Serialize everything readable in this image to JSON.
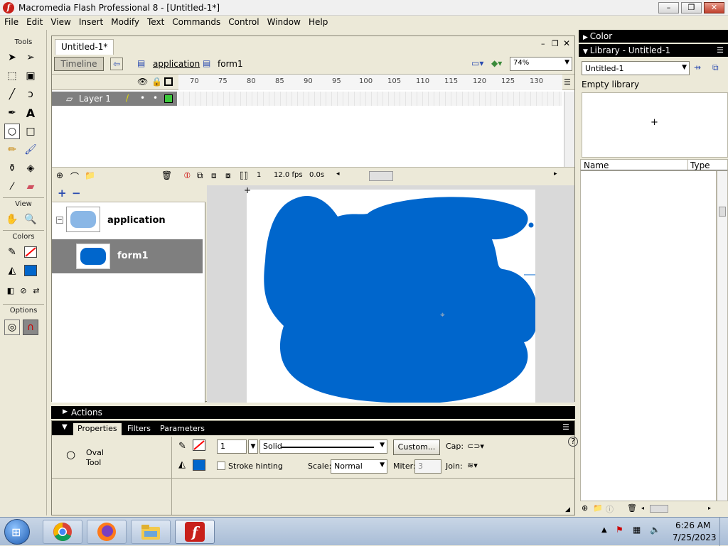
{
  "window": {
    "title": "Macromedia Flash Professional 8 - [Untitled-1*]",
    "app_icon": "f"
  },
  "menu": [
    "File",
    "Edit",
    "View",
    "Insert",
    "Modify",
    "Text",
    "Commands",
    "Control",
    "Window",
    "Help"
  ],
  "tools": {
    "label": "Tools",
    "view_label": "View",
    "colors_label": "Colors",
    "options_label": "Options",
    "stroke_color": "#ff0000",
    "fill_color": "#0066cc"
  },
  "document": {
    "tab": "Untitled-1*",
    "timeline_button": "Timeline",
    "breadcrumb": [
      "application",
      "form1"
    ],
    "zoom": "74%",
    "layer_name": "Layer 1",
    "ruler": [
      "70",
      "75",
      "80",
      "85",
      "90",
      "95",
      "100",
      "105",
      "110",
      "115",
      "120",
      "125",
      "130"
    ],
    "frame": "1",
    "fps": "12.0 fps",
    "time": "0.0s"
  },
  "screens": {
    "items": [
      {
        "label": "application"
      },
      {
        "label": "form1"
      }
    ]
  },
  "stage": {
    "shape_color": "#0066cc"
  },
  "actions_label": "Actions",
  "properties": {
    "tabs": [
      "Properties",
      "Filters",
      "Parameters"
    ],
    "tool_name_line1": "Oval",
    "tool_name_line2": "Tool",
    "stroke_height": "1",
    "stroke_style": "Solid",
    "custom_button": "Custom...",
    "cap_label": "Cap:",
    "stroke_hinting_label": "Stroke hinting",
    "scale_label": "Scale:",
    "scale_value": "Normal",
    "miter_label": "Miter:",
    "miter_value": "3",
    "join_label": "Join:"
  },
  "right_panel": {
    "color_header": "Color",
    "library_header": "Library - Untitled-1",
    "library_select": "Untitled-1",
    "empty_text": "Empty library",
    "col_name": "Name",
    "col_type": "Type"
  },
  "taskbar": {
    "time": "6:26 AM",
    "date": "7/25/2023"
  }
}
